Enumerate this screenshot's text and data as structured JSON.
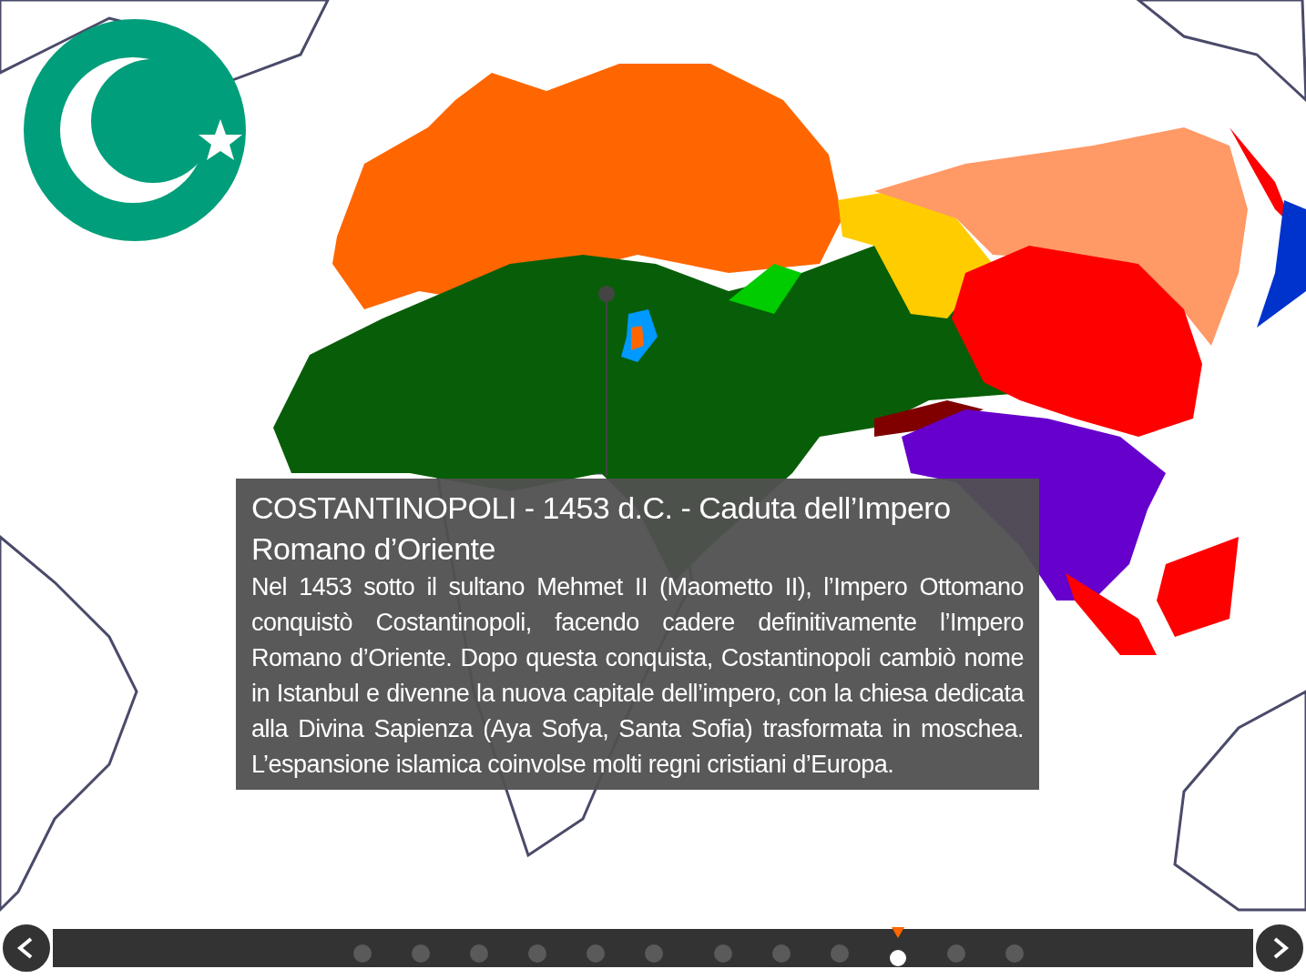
{
  "info_panel": {
    "title": "COSTANTINOPOLI - 1453 d.C. - Caduta dell’Impero Romano d’Oriente",
    "body": "Nel 1453 sotto il sultano Mehmet II (Maometto II), l’Impero Ottomano conquistò Costantinopoli, facendo cadere definitivamente l’Impero Romano d’Oriente. Dopo questa conquista, Costantinopoli cambiò nome in Istanbul e divenne la nuova capitale dell’impero, con la chiesa dedicata alla Divina Sapienza (Aya Sofya, Santa Sofia) trasformata in moschea. L’espansione islamica coinvolse molti regni cristiani d’Europa."
  },
  "timeline": {
    "steps": [
      {
        "selected": false
      },
      {
        "selected": false
      },
      {
        "selected": false
      },
      {
        "selected": false
      },
      {
        "selected": false
      },
      {
        "selected": false
      },
      {
        "selected": false
      },
      {
        "selected": false
      },
      {
        "selected": false
      },
      {
        "selected": true
      },
      {
        "selected": false
      },
      {
        "selected": false
      }
    ]
  }
}
